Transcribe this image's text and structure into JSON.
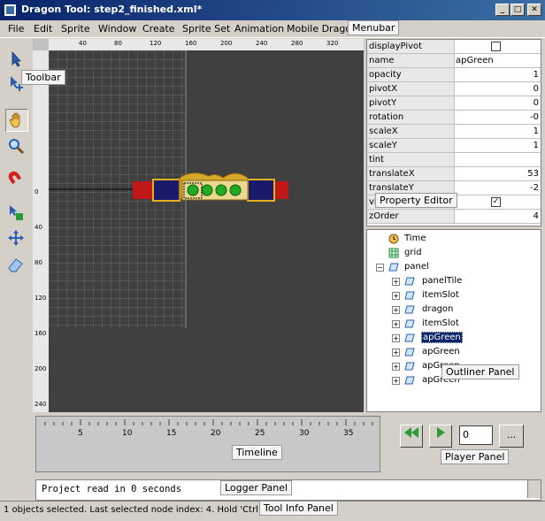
{
  "window": {
    "title": "Dragon Tool: step2_finished.xml*",
    "minimize_glyph": "_",
    "maximize_glyph": "□",
    "close_glyph": "✕"
  },
  "menubar": {
    "items": [
      "File",
      "Edit",
      "Sprite",
      "Window",
      "Create",
      "Sprite Set",
      "Animation",
      "Mobile Dragon"
    ],
    "tag": "Menubar"
  },
  "toolbar": {
    "tag": "Toolbar",
    "icons": [
      "select-arrow-icon",
      "move-select-icon",
      "hand-icon",
      "zoom-icon",
      "magnet-icon",
      "transform-icon",
      "multi-move-icon",
      "eraser-icon"
    ]
  },
  "ruler": {
    "top_labels": [
      "0",
      "40",
      "80",
      "120",
      "160",
      "200",
      "240",
      "280",
      "320",
      "360"
    ],
    "left_labels": [
      "40",
      "0",
      "40",
      "80",
      "120",
      "160",
      "200",
      "240"
    ]
  },
  "property_editor": {
    "tag": "Property Editor",
    "rows": [
      {
        "name": "displayPivot",
        "value": "",
        "type": "checkbox",
        "checked": false
      },
      {
        "name": "name",
        "value": "apGreen",
        "type": "text"
      },
      {
        "name": "opacity",
        "value": "1",
        "type": "number"
      },
      {
        "name": "pivotX",
        "value": "0",
        "type": "number"
      },
      {
        "name": "pivotY",
        "value": "0",
        "type": "number"
      },
      {
        "name": "rotation",
        "value": "-0",
        "type": "number"
      },
      {
        "name": "scaleX",
        "value": "1",
        "type": "number"
      },
      {
        "name": "scaleY",
        "value": "1",
        "type": "number"
      },
      {
        "name": "tint",
        "value": "",
        "type": "text"
      },
      {
        "name": "translateX",
        "value": "53",
        "type": "number"
      },
      {
        "name": "translateY",
        "value": "-2",
        "type": "number"
      },
      {
        "name": "visible",
        "value": "",
        "type": "checkbox",
        "checked": true
      },
      {
        "name": "zOrder",
        "value": "4",
        "type": "number"
      }
    ]
  },
  "outliner": {
    "tag": "Outliner Panel",
    "nodes": [
      {
        "label": "Time",
        "level": 0,
        "icon": "clock-icon",
        "expander": "",
        "selected": false
      },
      {
        "label": "grid",
        "level": 0,
        "icon": "grid-icon",
        "expander": "",
        "selected": false
      },
      {
        "label": "panel",
        "level": 0,
        "icon": "sprite-icon",
        "expander": "−",
        "selected": false
      },
      {
        "label": "panelTile",
        "level": 1,
        "icon": "sprite-icon",
        "expander": "+",
        "selected": false
      },
      {
        "label": "itemSlot",
        "level": 1,
        "icon": "sprite-icon",
        "expander": "+",
        "selected": false
      },
      {
        "label": "dragon",
        "level": 1,
        "icon": "sprite-icon",
        "expander": "+",
        "selected": false
      },
      {
        "label": "itemSlot",
        "level": 1,
        "icon": "sprite-icon",
        "expander": "+",
        "selected": false
      },
      {
        "label": "apGreen",
        "level": 1,
        "icon": "sprite-icon",
        "expander": "+",
        "selected": true
      },
      {
        "label": "apGreen",
        "level": 1,
        "icon": "sprite-icon",
        "expander": "+",
        "selected": false
      },
      {
        "label": "apGreen",
        "level": 1,
        "icon": "sprite-icon",
        "expander": "+",
        "selected": false
      },
      {
        "label": "apGreen",
        "level": 1,
        "icon": "sprite-icon",
        "expander": "+",
        "selected": false
      }
    ]
  },
  "timeline": {
    "tag": "Timeline",
    "labels": [
      "5",
      "10",
      "15",
      "20",
      "25",
      "30",
      "35"
    ]
  },
  "player": {
    "tag": "Player Panel",
    "frame_value": "0",
    "more_label": "..."
  },
  "logger": {
    "tag": "Logger Panel",
    "text": "Project read in 0 seconds"
  },
  "status": {
    "tag": "Tool Info Panel",
    "text": "1 objects selected. Last selected node index: 4. Hold 'Ctrl' t"
  },
  "colors": {
    "canvas_bg": "#404040",
    "grid_line": "#6a6a6a",
    "selection": "#0a246a",
    "tint_green": "#22aa22"
  }
}
